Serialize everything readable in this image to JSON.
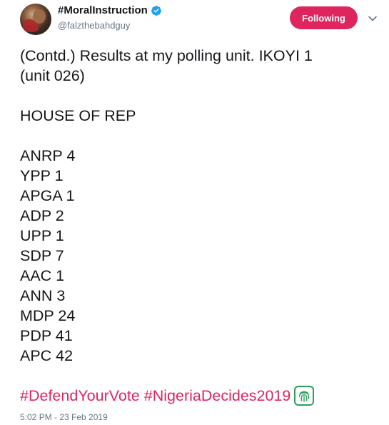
{
  "author": {
    "display_name": "#MoralInstruction",
    "handle": "@falzthebahdguy",
    "verified": true
  },
  "follow_button": {
    "label": "Following",
    "color": "#e0245e"
  },
  "tweet": {
    "lines": [
      "(Contd.) Results at my polling unit. IKOYI 1",
      "(unit 026)",
      "",
      "HOUSE OF REP",
      "",
      "ANRP 4",
      "YPP 1",
      "APGA 1",
      "ADP 2",
      "UPP 1",
      "SDP 7",
      "AAC 1",
      "ANN 3",
      "MDP 24",
      "PDP 41",
      "APC 42",
      ""
    ],
    "hashtags": [
      "#DefendYourVote",
      "#NigeriaDecides2019"
    ],
    "hashtag_emoji": "fingerprint-icon"
  },
  "timestamp": "5:02 PM - 23 Feb 2019",
  "colors": {
    "accent": "#e0245e",
    "verified": "#1da1f2",
    "muted": "#657786",
    "emoji_green": "#2ca05a"
  }
}
